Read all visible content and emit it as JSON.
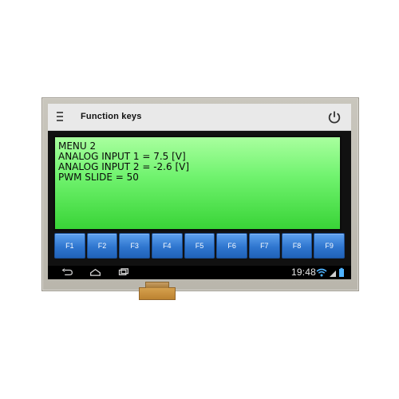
{
  "app": {
    "title": "Function keys"
  },
  "display": {
    "lines": [
      "MENU 2",
      "ANALOG INPUT 1 = 7.5 [V]",
      "ANALOG INPUT 2 = -2.6 [V]",
      "PWM SLIDE = 50"
    ]
  },
  "function_keys": [
    "F1",
    "F2",
    "F3",
    "F4",
    "F5",
    "F6",
    "F7",
    "F8",
    "F9"
  ],
  "status_bar": {
    "time": "19:48",
    "icons": [
      "wifi-icon",
      "signal-icon",
      "battery-icon"
    ]
  },
  "navigation": {
    "icons": [
      "back-icon",
      "home-icon",
      "recent-apps-icon"
    ]
  },
  "header_icons": {
    "left": "menu-icon",
    "right": "power-icon"
  },
  "colors": {
    "display_green": "#71f36f",
    "button_blue": "#2f76cf",
    "app_bar_gray": "#e9e9e9",
    "bezel_gray": "#c9c6bd"
  }
}
